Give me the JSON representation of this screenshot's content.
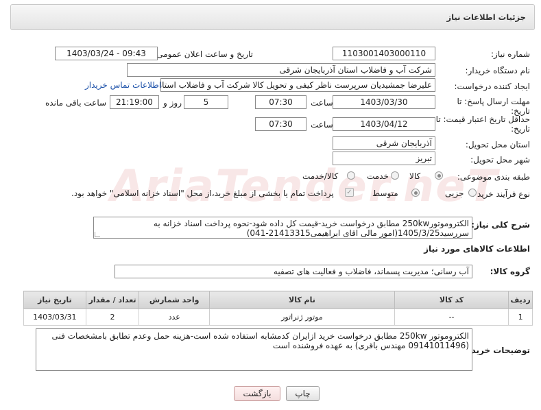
{
  "header": {
    "title": "جزئیات اطلاعات نیاز"
  },
  "form": {
    "need_number_label": "شماره نیاز:",
    "need_number": "1103001403000110",
    "announce_label": "تاریخ و ساعت اعلان عمومی:",
    "announce_value": "1403/03/24 - 09:43",
    "buyer_org_label": "نام دستگاه خریدار:",
    "buyer_org": "شرکت آب و فاضلاب استان آذربایجان شرقی",
    "creator_label": "ایجاد کننده درخواست:",
    "creator": "علیرضا جمشیدیان سرپرست ناظر کیفی و تحویل کالا شرکت آب و فاضلاب استان",
    "contact_link": "اطلاعات تماس خریدار",
    "reply_deadline_label_1": "مهلت ارسال پاسخ: تا",
    "reply_deadline_label_2": "تاریخ:",
    "reply_date": "1403/03/30",
    "time_label": "ساعت",
    "reply_time": "07:30",
    "days_value": "5",
    "days_label": "روز و",
    "remaining_time": "21:19:00",
    "remaining_label": "ساعت باقی مانده",
    "price_validity_label_1": "حداقل تاریخ اعتبار قیمت: تا",
    "price_validity_label_2": "تاریخ:",
    "price_date": "1403/04/12",
    "price_time": "07:30",
    "province_label": "استان محل تحویل:",
    "province": "آذربایجان شرقی",
    "city_label": "شهر محل تحویل:",
    "city": "تبریز",
    "category_label": "طبقه بندی موضوعی:",
    "category_options": [
      "کالا",
      "خدمت",
      "کالا/خدمت"
    ],
    "process_label": "نوع فرآیند خرید :",
    "process_options": [
      "جزیی",
      "متوسط"
    ],
    "payment_note": "پرداخت تمام یا بخشی از مبلغ خرید،از محل \"اسناد خزانه اسلامی\" خواهد بود.",
    "description_label": "شرح کلی نیاز:",
    "description_line1": "الکتروموتور250kw  مطابق درخواست خرید-قیمت کل داده شود-نحوه پرداخت اسناد خزانه  به",
    "description_line2": "سررسید1405/3/25(امور مالی اقای ابراهیمی21413315-041)"
  },
  "goods": {
    "section_title": "اطلاعات کالاهای مورد نیاز",
    "group_label": "گروه کالا:",
    "group_value": "آب رسانی؛ مدیریت پسماند، فاضلاب و فعالیت های تصفیه",
    "columns": [
      "ردیف",
      "کد کالا",
      "نام کالا",
      "واحد شمارش",
      "تعداد / مقدار",
      "تاریخ نیاز"
    ],
    "rows": [
      [
        "1",
        "--",
        "موتور ژنراتور",
        "عدد",
        "2",
        "1403/03/31"
      ]
    ]
  },
  "buyer_notes": {
    "label": "توضیحات خریدار:",
    "line1": "الکتروموتور 250kw مطابق درخواست خرید ازایران کدمشابه استفاده شده است-هزینه حمل وعدم تطابق بامشخصات فنی",
    "line2": "(09141011496 مهندس باقری) به عهده فروشنده است"
  },
  "buttons": {
    "print": "چاپ",
    "back": "بازگشت"
  },
  "watermark": "AriaTender.neT"
}
